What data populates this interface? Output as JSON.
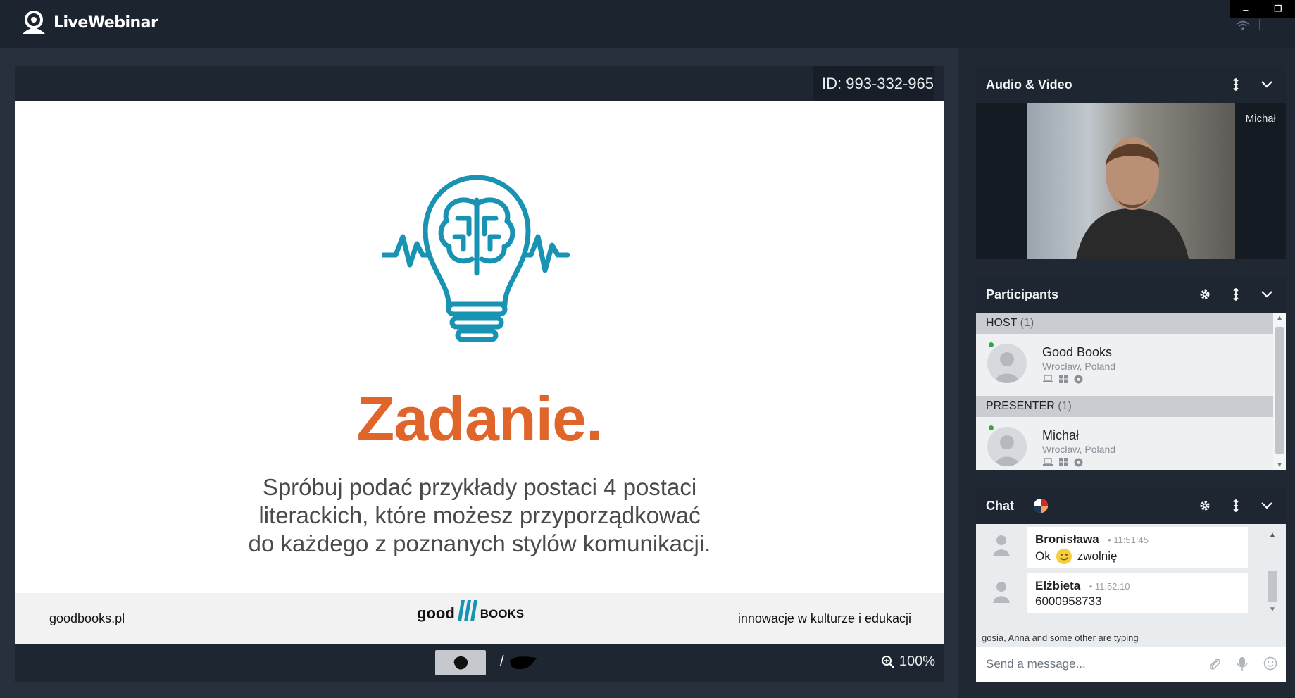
{
  "app": {
    "name": "LiveWebinar"
  },
  "window": {
    "minimize_glyph": "–",
    "restore_glyph": "❐"
  },
  "stage": {
    "meeting_id": "ID: 993-332-965",
    "slide": {
      "title": "Zadanie.",
      "body_lines": [
        "Spróbuj podać przykłady postaci 4 postaci",
        "literackich, które możesz przyporządkować",
        "do każdego z poznanych stylów komunikacji."
      ],
      "footer_left": "goodbooks.pl",
      "footer_logo_left": "good",
      "footer_logo_right": "books",
      "footer_right": "innowacje w kulturze i edukacji"
    },
    "controls": {
      "page_separator": "/",
      "zoom": "100%"
    }
  },
  "audio_video": {
    "title": "Audio & Video",
    "participant_name": "Michał"
  },
  "participants": {
    "title": "Participants",
    "groups": [
      {
        "label": "HOST",
        "count": "(1)",
        "members": [
          {
            "name": "Good Books",
            "location": "Wrocław, Poland"
          }
        ]
      },
      {
        "label": "PRESENTER",
        "count": "(1)",
        "members": [
          {
            "name": "Michał",
            "location": "Wrocław, Poland"
          }
        ]
      }
    ]
  },
  "chat": {
    "title": "Chat",
    "messages": [
      {
        "sender": "Bronisława",
        "time": "11:51:45",
        "text_before": "Ok",
        "has_emoji": true,
        "text_after": "zwolnię"
      },
      {
        "sender": "Elżbieta",
        "time": "11:52:10",
        "text_before": "6000958733"
      }
    ],
    "typing_names": "gosia, Anna",
    "typing_suffix": " and some other are typing",
    "input_placeholder": "Send a message..."
  },
  "colors": {
    "accent_orange": "#e0652a",
    "bulb_teal": "#1893b3",
    "online_green": "#2ea84a"
  }
}
